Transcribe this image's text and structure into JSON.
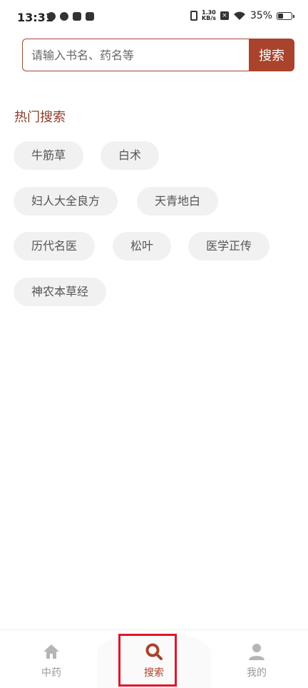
{
  "status_bar": {
    "time": "13:31",
    "net_speed_value": "1.30",
    "net_speed_unit": "KB/s",
    "battery_percent": "35%",
    "battery_level": 0.35
  },
  "search": {
    "placeholder": "请输入书名、药名等",
    "button_label": "搜索"
  },
  "hot_search": {
    "title": "热门搜索",
    "tags": [
      "牛筋草",
      "白术",
      "妇人大全良方",
      "天青地白",
      "历代名医",
      "松叶",
      "医学正传",
      "神农本草经"
    ]
  },
  "bottom_nav": {
    "items": [
      {
        "label": "中药",
        "icon": "home-icon"
      },
      {
        "label": "搜索",
        "icon": "search-icon"
      },
      {
        "label": "我的",
        "icon": "user-icon"
      }
    ],
    "active_index": 1,
    "accent_color": "#a9432b"
  }
}
